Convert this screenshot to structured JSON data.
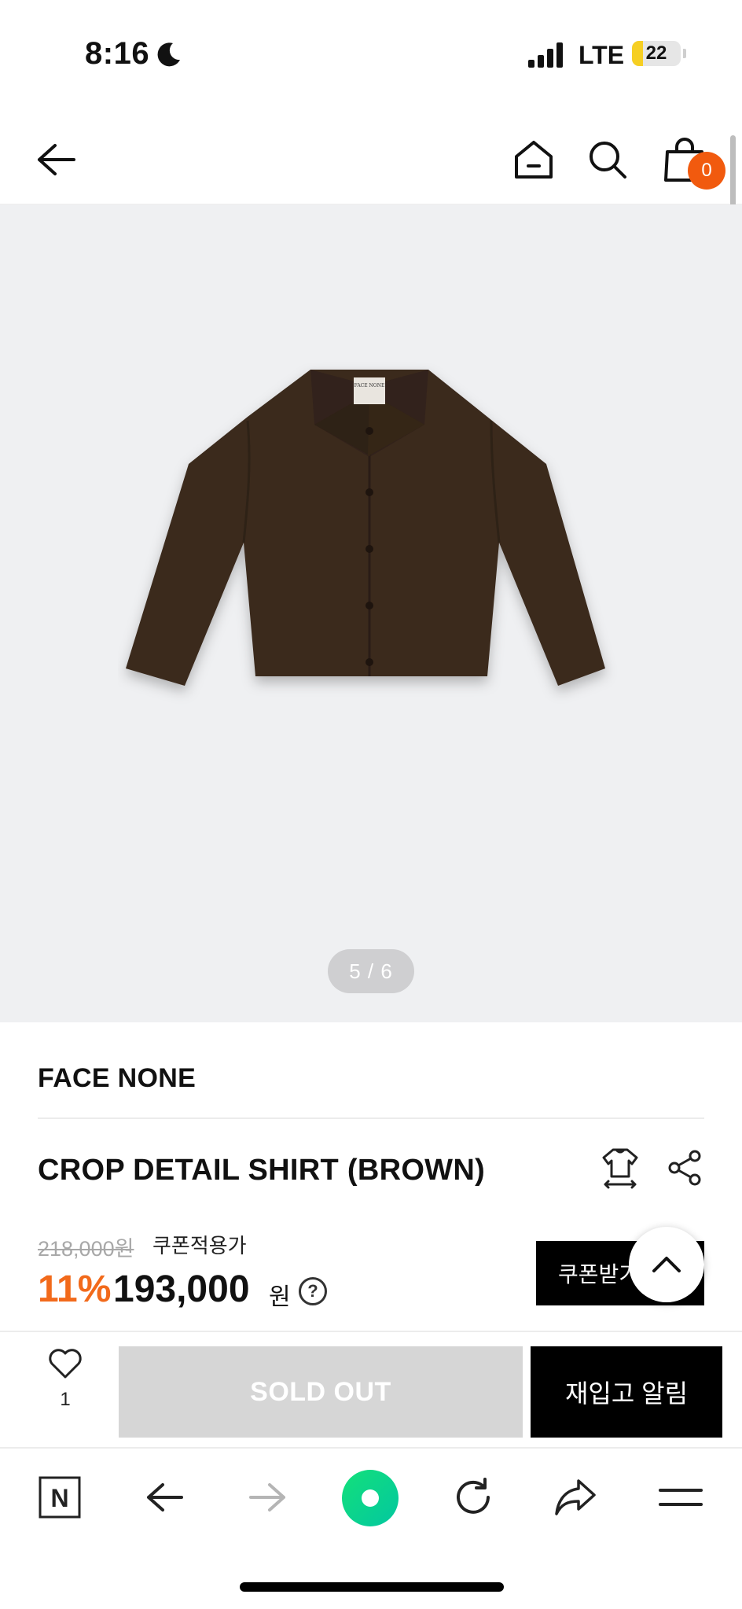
{
  "status_bar": {
    "time": "8:16",
    "network": "LTE",
    "battery": "22",
    "battery_level": 0.22
  },
  "header": {
    "cart_count": "0"
  },
  "gallery": {
    "pager": "5 / 6",
    "current_page": 5,
    "total_pages": 6,
    "label_on_shirt": "FACE NONE"
  },
  "product": {
    "brand": "FACE NONE",
    "name": "CROP DETAIL SHIRT (BROWN)",
    "original_price": "218,000원",
    "coupon_price_label": "쿠폰적용가",
    "discount": "11%",
    "price": "193,000",
    "currency": "원",
    "help": "?"
  },
  "coupon_button": {
    "label": "쿠폰받기"
  },
  "purchase_bar": {
    "like_count": "1",
    "soldout_label": "SOLD OUT",
    "restock_label": "재입고 알림"
  },
  "browser_toolbar": {
    "naver_label": "N"
  },
  "colors": {
    "accent": "#f26a1b",
    "badge": "#f15a0e",
    "naver_green": "#03c75a",
    "shirt": "#3b2a1e"
  }
}
